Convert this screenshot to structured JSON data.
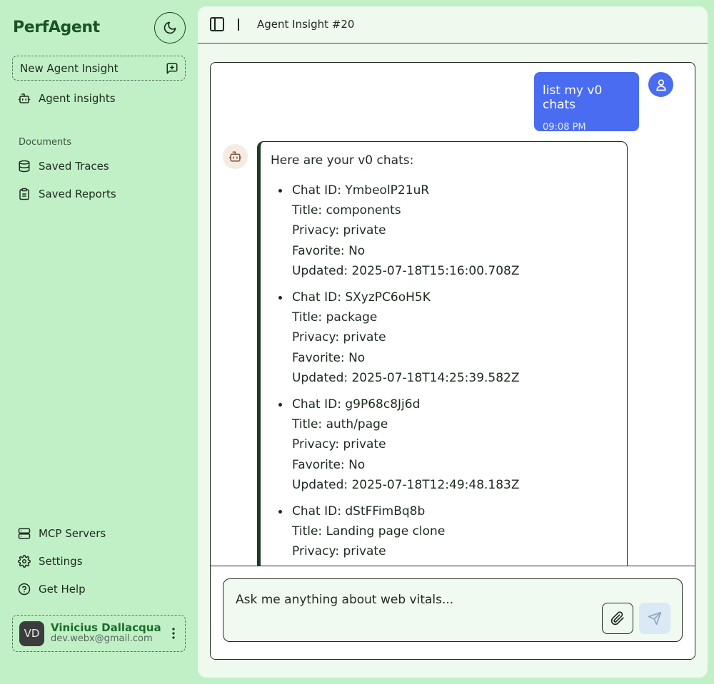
{
  "app": {
    "brand": "PerfAgent"
  },
  "sidebar": {
    "new_insight_label": "New Agent Insight",
    "primary_items": [
      {
        "label": "Agent insights",
        "icon": "bot-icon"
      }
    ],
    "section_label": "Documents",
    "document_items": [
      {
        "label": "Saved Traces",
        "icon": "database-icon"
      },
      {
        "label": "Saved Reports",
        "icon": "clipboard-icon"
      }
    ],
    "bottom_items": [
      {
        "label": "MCP Servers",
        "icon": "server-icon"
      },
      {
        "label": "Settings",
        "icon": "gear-icon"
      },
      {
        "label": "Get Help",
        "icon": "help-circle-icon"
      }
    ],
    "user": {
      "initials": "VD",
      "name": "Vinicius Dallacqua",
      "email": "dev.webx@gmail.com"
    }
  },
  "header": {
    "title": "Agent Insight #20"
  },
  "conversation": {
    "user_message": {
      "text": "list my v0 chats",
      "time": "09:08 PM"
    },
    "assistant_message": {
      "intro": "Here are your v0 chats:",
      "chats": [
        {
          "id_line": "Chat ID: YmbeolP21uR",
          "title_line": "Title: components",
          "privacy_line": "Privacy: private",
          "favorite_line": "Favorite: No",
          "updated_line": "Updated: 2025-07-18T15:16:00.708Z"
        },
        {
          "id_line": "Chat ID: SXyzPC6oH5K",
          "title_line": "Title: package",
          "privacy_line": "Privacy: private",
          "favorite_line": "Favorite: No",
          "updated_line": "Updated: 2025-07-18T14:25:39.582Z"
        },
        {
          "id_line": "Chat ID: g9P68c8Jj6d",
          "title_line": "Title: auth/page",
          "privacy_line": "Privacy: private",
          "favorite_line": "Favorite: No",
          "updated_line": "Updated: 2025-07-18T12:49:48.183Z"
        },
        {
          "id_line": "Chat ID: dStFFimBq8b",
          "title_line": "Title: Landing page clone",
          "privacy_line": "Privacy: private",
          "favorite_line": "",
          "updated_line": ""
        }
      ]
    }
  },
  "composer": {
    "placeholder": "Ask me anything about web vitals..."
  },
  "colors": {
    "app_background": "#c1f0c6",
    "brand": "#1b5226",
    "user_bubble": "#4a6cf0",
    "panel": "#effaef",
    "send_button": "#dbe8f5"
  }
}
